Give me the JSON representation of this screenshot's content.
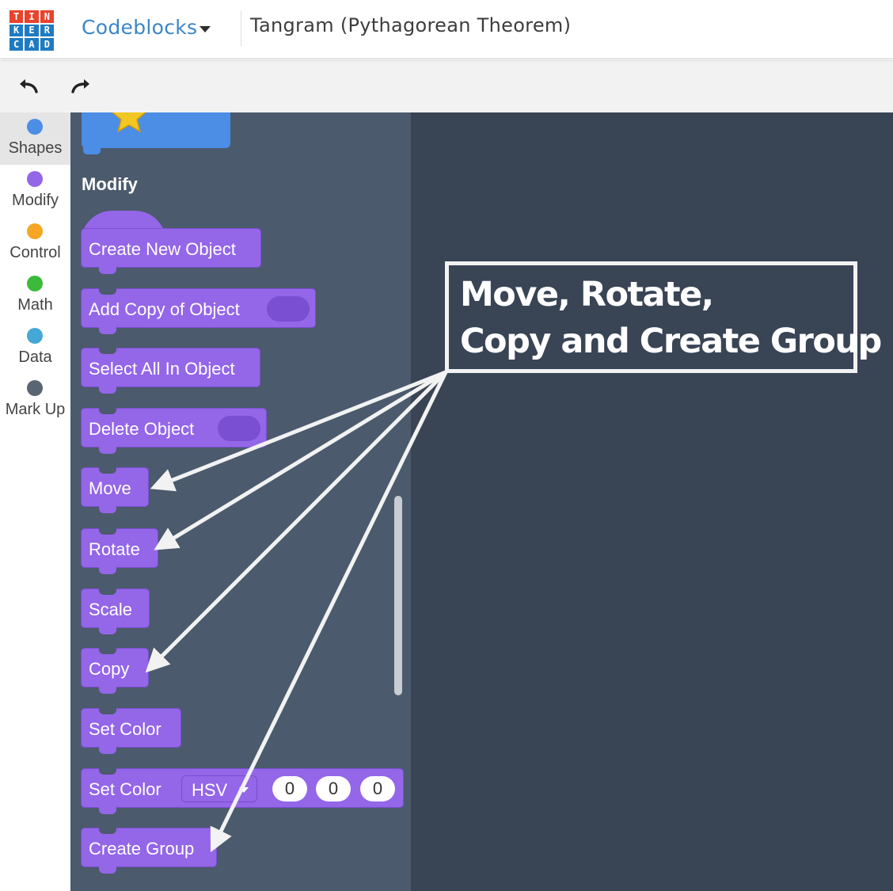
{
  "header": {
    "logo_letters": [
      "T",
      "I",
      "N",
      "K",
      "E",
      "R",
      "C",
      "A",
      "D"
    ],
    "logo_colors": [
      "#e8432b",
      "#e8432b",
      "#e8432b",
      "#1f7bc1",
      "#1f7bc1",
      "#1f7bc1",
      "#1f7bc1",
      "#1f7bc1",
      "#1f7bc1"
    ],
    "mode_label": "Codeblocks",
    "project_title": "Tangram (Pythagorean Theorem)"
  },
  "toolbar": {
    "undo_icon": "undo-arrow",
    "redo_icon": "redo-arrow"
  },
  "categories": [
    {
      "label": "Shapes",
      "color": "#4c8de6",
      "active": true
    },
    {
      "label": "Modify",
      "color": "#9466e8",
      "active": false
    },
    {
      "label": "Control",
      "color": "#f5a623",
      "active": false
    },
    {
      "label": "Math",
      "color": "#3cba3c",
      "active": false
    },
    {
      "label": "Data",
      "color": "#45a7d6",
      "active": false
    },
    {
      "label": "Mark Up",
      "color": "#5a6573",
      "active": false
    }
  ],
  "flyout": {
    "section_title": "Modify",
    "blocks": [
      {
        "label": "Create New Object"
      },
      {
        "label": "Add Copy of Object"
      },
      {
        "label": "Select All In Object"
      },
      {
        "label": "Delete Object"
      },
      {
        "label": "Move"
      },
      {
        "label": "Rotate"
      },
      {
        "label": "Scale"
      },
      {
        "label": "Copy"
      },
      {
        "label": "Set Color"
      },
      {
        "label": "Set Color",
        "mode": "HSV",
        "values": [
          "0",
          "0",
          "0"
        ]
      },
      {
        "label": "Create Group"
      }
    ]
  },
  "callout": {
    "line1": "Move, Rotate,",
    "line2": "Copy and Create Group"
  },
  "colors": {
    "flyout_bg": "#4b5a6c",
    "workspace_bg": "#394455",
    "modify_block": "#9466e8",
    "shapes_block": "#4c8de6"
  }
}
